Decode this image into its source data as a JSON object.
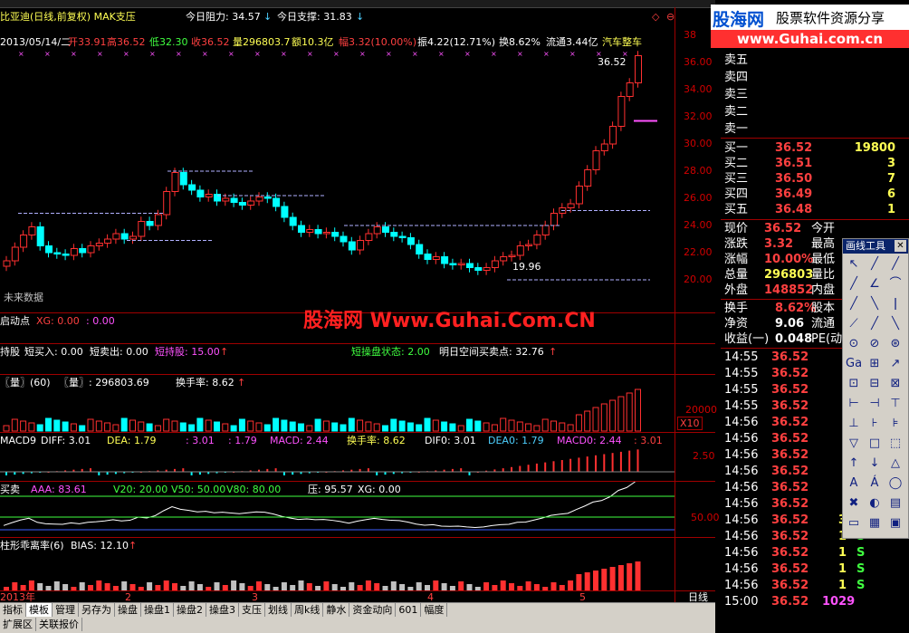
{
  "header": {
    "stock_title": "比亚迪(日线,前复权) MAK支压",
    "resistance_label": "今日阻力: 34.57",
    "support_label": "今日支撑: 31.83",
    "info_date": "2013/05/14/二",
    "open": "开33.91",
    "high": "高36.52",
    "low": "低32.30",
    "close": "收36.52",
    "volume": "量296803.7",
    "amount": "额10.3亿",
    "change": "幅3.32(10.00%)",
    "amplitude": "振4.22(12.71%)",
    "turnover": "换8.62%",
    "float_cap": "流通3.44亿",
    "sector": "汽车整车"
  },
  "price_axis": [
    "38",
    "36.00",
    "34.00",
    "32.00",
    "30.00",
    "28.00",
    "26.00",
    "24.00",
    "22.00",
    "20.00"
  ],
  "price_marks": {
    "high_mark": "36.52",
    "low_mark": "19.96"
  },
  "future_data_label": "未来数据",
  "watermark": "股海网 Www.Guhai.Com.CN",
  "indicators": {
    "start": {
      "name": "启动点",
      "xg": "XG: 0.00",
      "val": ": 0.00"
    },
    "hold": {
      "name": "持股",
      "buy": "短买入: 0.00",
      "sell": "短卖出: 0.00",
      "hold_short": "短持股: 15.00",
      "state": "短操盘状态: 2.00",
      "next_buy": "明日空间买卖点: 32.76"
    },
    "volume": {
      "name": "〖量〗(60)",
      "value": "〖量〗: 296803.69",
      "turnover": "换手率: 8.62",
      "axis": "20000",
      "unit": "X10"
    },
    "macd": {
      "name": "MACD9",
      "diff": "DIFF: 3.01",
      "dea": "DEA: 1.79",
      "v1": ": 3.01",
      "v2": ": 1.79",
      "macd": "MACD: 2.44",
      "turn": "换手率: 8.62",
      "dif0": "DIF0: 3.01",
      "dea0": "DEA0: 1.79",
      "macd0": "MACD0: 2.44",
      "v3": ": 3.01",
      "axis": "2.50"
    },
    "buysell": {
      "name": "买卖",
      "aaa": "AAA: 83.61",
      "v20": "V20: 20.00",
      "v50": "V50: 50.00",
      "v80": "V80: 80.00",
      "press": "压: 95.57",
      "xg": "XG: 0.00",
      "axis": "50.00"
    },
    "bias": {
      "name": "柱形乖离率(6)",
      "bias": "BIAS: 12.10"
    }
  },
  "time_axis": [
    "2013年",
    "2",
    "3",
    "4",
    "5"
  ],
  "period_label": "日线",
  "bottom_tabs": [
    "指标",
    "模板",
    "管理",
    "另存为",
    "操盘",
    "操盘1",
    "操盘2",
    "操盘3",
    "支压",
    "划线",
    "周k线",
    "静水",
    "资金动向",
    "601",
    "幅度"
  ],
  "bottom_tabs2": [
    "扩展区",
    "关联报价"
  ],
  "logo": {
    "brand": "股海网",
    "slogan": "股票软件资源分享",
    "url": "www.Guhai.com.cn"
  },
  "quote": {
    "asks": [
      {
        "label": "卖五",
        "price": "",
        "vol": ""
      },
      {
        "label": "卖四",
        "price": "",
        "vol": ""
      },
      {
        "label": "卖三",
        "price": "",
        "vol": ""
      },
      {
        "label": "卖二",
        "price": "",
        "vol": ""
      },
      {
        "label": "卖一",
        "price": "",
        "vol": ""
      }
    ],
    "bids": [
      {
        "label": "买一",
        "price": "36.52",
        "vol": "19800"
      },
      {
        "label": "买二",
        "price": "36.51",
        "vol": "3"
      },
      {
        "label": "买三",
        "price": "36.50",
        "vol": "7"
      },
      {
        "label": "买四",
        "price": "36.49",
        "vol": "6"
      },
      {
        "label": "买五",
        "price": "36.48",
        "vol": "1"
      }
    ],
    "stats": [
      {
        "l1": "现价",
        "v1": "36.52",
        "l2": "今开"
      },
      {
        "l1": "涨跌",
        "v1": "3.32",
        "l2": "最高"
      },
      {
        "l1": "涨幅",
        "v1": "10.00%",
        "l2": "最低"
      },
      {
        "l1": "总量",
        "v1": "296803",
        "l2": "量比"
      },
      {
        "l1": "外盘",
        "v1": "148852",
        "l2": "内盘"
      }
    ],
    "stats2": [
      {
        "l1": "换手",
        "v1": "8.62%",
        "l2": "股本"
      },
      {
        "l1": "净资",
        "v1": "9.06",
        "l2": "流通"
      },
      {
        "l1": "收益(一)",
        "v1": "0.048",
        "l2": "PE(动)"
      }
    ]
  },
  "ticks": [
    {
      "time": "14:55",
      "price": "36.52",
      "vol": "",
      "bs": ""
    },
    {
      "time": "14:55",
      "price": "36.52",
      "vol": "",
      "bs": ""
    },
    {
      "time": "14:55",
      "price": "36.52",
      "vol": "",
      "bs": ""
    },
    {
      "time": "14:55",
      "price": "36.52",
      "vol": "",
      "bs": ""
    },
    {
      "time": "14:56",
      "price": "36.52",
      "vol": "",
      "bs": ""
    },
    {
      "time": "14:56",
      "price": "36.52",
      "vol": "",
      "bs": ""
    },
    {
      "time": "14:56",
      "price": "36.52",
      "vol": "",
      "bs": ""
    },
    {
      "time": "14:56",
      "price": "36.52",
      "vol": "",
      "bs": ""
    },
    {
      "time": "14:56",
      "price": "36.52",
      "vol": "",
      "bs": ""
    },
    {
      "time": "14:56",
      "price": "36.52",
      "vol": "",
      "bs": ""
    },
    {
      "time": "14:56",
      "price": "36.52",
      "vol": "3",
      "bs": "S"
    },
    {
      "time": "14:56",
      "price": "36.52",
      "vol": "1",
      "bs": "S"
    },
    {
      "time": "14:56",
      "price": "36.52",
      "vol": "1",
      "bs": "S"
    },
    {
      "time": "14:56",
      "price": "36.52",
      "vol": "1",
      "bs": "S"
    },
    {
      "time": "14:56",
      "price": "36.52",
      "vol": "1",
      "bs": "S"
    },
    {
      "time": "15:00",
      "price": "36.52",
      "vol": "1029",
      "bs": ""
    }
  ],
  "toolbox": {
    "title": "画线工具"
  },
  "colors": {
    "up": "#ff3030",
    "down": "#00ffff",
    "axis": "#d00000",
    "bg": "#000000"
  }
}
